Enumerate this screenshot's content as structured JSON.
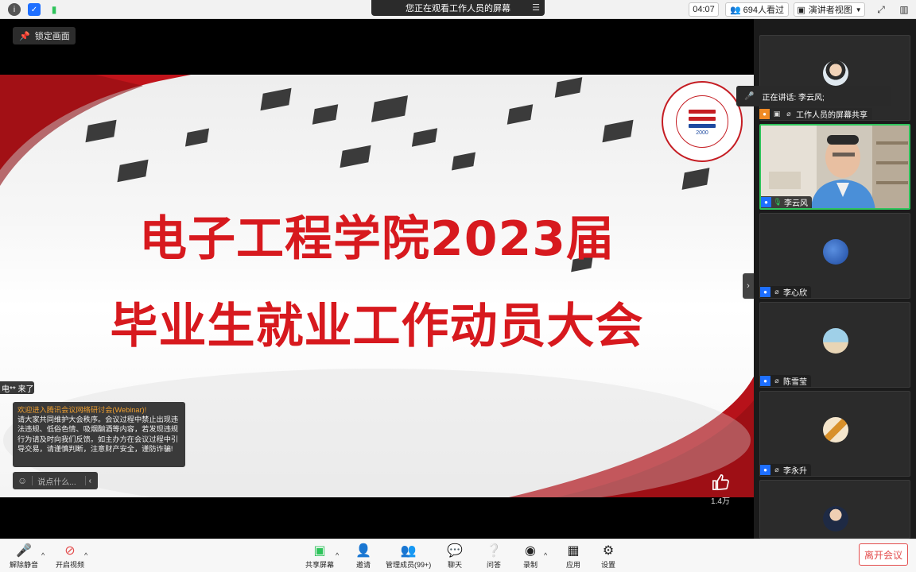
{
  "topbar": {
    "viewing_text": "您正在观看工作人员的屏幕",
    "timer": "04:07",
    "viewers": "694人看过",
    "view_mode": "演讲者视图"
  },
  "stage": {
    "lock_label": "锁定画面",
    "slide_title_line1": "电子工程学院2023届",
    "slide_title_line2": "毕业生就业工作动员大会",
    "logo_year": "2000",
    "like_count": "1.4万"
  },
  "chat": {
    "joined": "电** 来了",
    "notice_title": "欢迎进入腾讯会议网络研讨会(Webinar)!",
    "notice_body": "请大家共同维护大会秩序。会议过程中禁止出现违法违规、低俗色情、吸烟酗酒等内容，若发现违规行为请及时向我们反馈。如主办方在会议过程中引导交易，请谨慎判断，注意财产安全，谨防诈骗!",
    "placeholder": "说点什么..."
  },
  "sidebar": {
    "speaking": "正在讲话: 李云风;",
    "share_label": "工作人员的屏幕共享",
    "participants": [
      {
        "name": "李云风"
      },
      {
        "name": "李心欣"
      },
      {
        "name": "陈雪莹"
      },
      {
        "name": "李永升"
      }
    ]
  },
  "toolbar": {
    "unmute": "解除静音",
    "start_video": "开启视频",
    "share_screen": "共享屏幕",
    "invite": "邀请",
    "manage_members": "管理成员(99+)",
    "chat": "聊天",
    "qa": "问答",
    "record": "录制",
    "apps": "应用",
    "settings": "设置",
    "leave": "离开会议"
  },
  "colors": {
    "accent_red": "#d7191e",
    "active_green": "#2ec45b",
    "user_blue": "#1e6fff"
  }
}
